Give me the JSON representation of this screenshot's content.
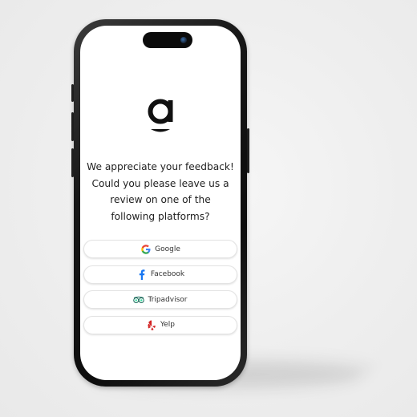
{
  "message": "We appreciate your feedback! Could you please leave us a review on one of the following platforms?",
  "options": [
    {
      "label": "Google",
      "icon": "google-icon"
    },
    {
      "label": "Facebook",
      "icon": "facebook-icon"
    },
    {
      "label": "Tripadvisor",
      "icon": "tripadvisor-icon"
    },
    {
      "label": "Yelp",
      "icon": "yelp-icon"
    }
  ],
  "colors": {
    "facebook": "#1877f2",
    "tripadvisor": "#34e0a1",
    "yelp": "#d32323",
    "text": "#222222"
  }
}
